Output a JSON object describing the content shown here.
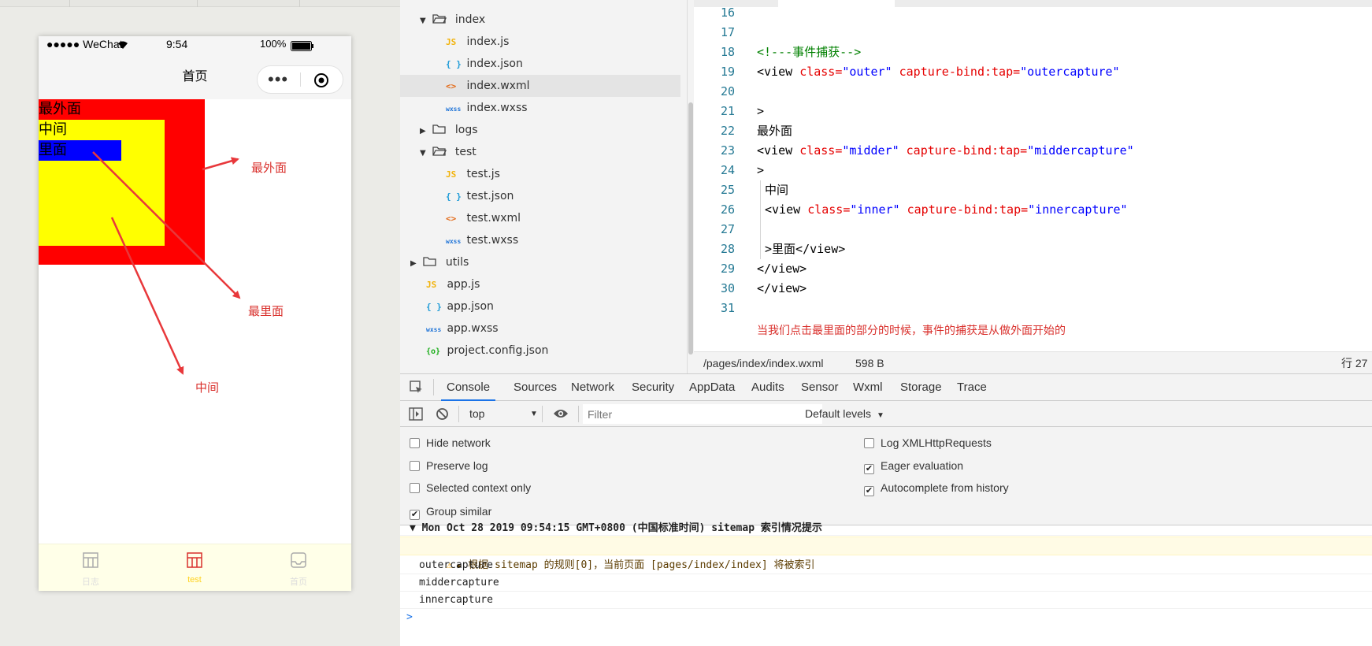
{
  "simulator": {
    "status_bar": {
      "carrier": "●●●●● WeChat",
      "time": "9:54",
      "battery": "100%"
    },
    "nav": {
      "title": "首页"
    },
    "boxes": {
      "outer_label": "最外面",
      "middle_label": "中间",
      "inner_label": "里面"
    },
    "tabbar": [
      {
        "label": "日志",
        "icon": "grid-icon"
      },
      {
        "label": "test",
        "icon": "grid-icon",
        "active": true
      },
      {
        "label": "首页",
        "icon": "inbox-icon"
      }
    ],
    "annotations": {
      "outermost": "最外面",
      "innermost": "最里面",
      "middle": "中间"
    },
    "colors": {
      "outer": "#ff0000",
      "middle": "#ffff00",
      "inner": "#0000ff",
      "tab_active": "#d9302c",
      "annotation": "#d9302c"
    }
  },
  "file_tree": [
    {
      "name": "index",
      "type": "folder",
      "expanded": true
    },
    {
      "name": "index.js",
      "type": "js"
    },
    {
      "name": "index.json",
      "type": "json"
    },
    {
      "name": "index.wxml",
      "type": "wxml",
      "selected": true
    },
    {
      "name": "index.wxss",
      "type": "wxss"
    },
    {
      "name": "logs",
      "type": "folder",
      "expanded": false
    },
    {
      "name": "test",
      "type": "folder",
      "expanded": true
    },
    {
      "name": "test.js",
      "type": "js"
    },
    {
      "name": "test.json",
      "type": "json"
    },
    {
      "name": "test.wxml",
      "type": "wxml"
    },
    {
      "name": "test.wxss",
      "type": "wxss"
    },
    {
      "name": "utils",
      "type": "folder",
      "expanded": false
    },
    {
      "name": "app.js",
      "type": "js"
    },
    {
      "name": "app.json",
      "type": "json"
    },
    {
      "name": "app.wxss",
      "type": "wxss"
    },
    {
      "name": "project.config.json",
      "type": "config"
    }
  ],
  "editor": {
    "lines": {
      "l16": "16",
      "l17": "17",
      "l18": "18",
      "l19": "19",
      "l20": "20",
      "l21": "21",
      "l22": "22",
      "l23": "23",
      "l24": "24",
      "l25": "25",
      "l26": "26",
      "l27": "27",
      "l28": "28",
      "l29": "29",
      "l30": "30",
      "l31": "31"
    },
    "code": {
      "comment": "<!---事件捕获-->",
      "tag_open_view": "<view ",
      "attr_class": "class=",
      "val_outer": "\"outer\"",
      "attr_capture": " capture-bind:tap=",
      "val_outercapture": "\"outercapture\"",
      "gt": ">",
      "text_outer": "最外面",
      "val_midder": "\"midder\"",
      "val_middercapture": "\"middercapture\"",
      "text_middle": "中间",
      "val_inner": "\"inner\"",
      "val_innercapture": "\"innercapture\"",
      "text_inner": "里面",
      "close_view": "</view>"
    },
    "note": "当我们点击最里面的部分的时候，事件的捕获是从做外面开始的",
    "status": {
      "path": "/pages/index/index.wxml",
      "size": "598 B",
      "line": "行 27"
    }
  },
  "devtools": {
    "tabs": [
      "Console",
      "Sources",
      "Network",
      "Security",
      "AppData",
      "Audits",
      "Sensor",
      "Wxml",
      "Storage",
      "Trace"
    ],
    "active_tab": "Console",
    "context": "top",
    "filter_placeholder": "Filter",
    "levels": "Default levels",
    "options_left": [
      {
        "label": "Hide network",
        "checked": false
      },
      {
        "label": "Preserve log",
        "checked": false
      },
      {
        "label": "Selected context only",
        "checked": false
      },
      {
        "label": "Group similar",
        "checked": true
      }
    ],
    "options_right": [
      {
        "label": "Log XMLHttpRequests",
        "checked": false
      },
      {
        "label": "Eager evaluation",
        "checked": true
      },
      {
        "label": "Autocomplete from history",
        "checked": true
      }
    ],
    "log": {
      "group": "▼ Mon Oct 28 2019 09:54:15 GMT+0800 (中国标准时间) sitemap 索引情况提示",
      "warning": "根据 sitemap 的规则[0]，当前页面 [pages/index/index] 将被索引",
      "entries": [
        "outercapture",
        "middercapture",
        "innercapture"
      ],
      "prompt": ">"
    }
  }
}
